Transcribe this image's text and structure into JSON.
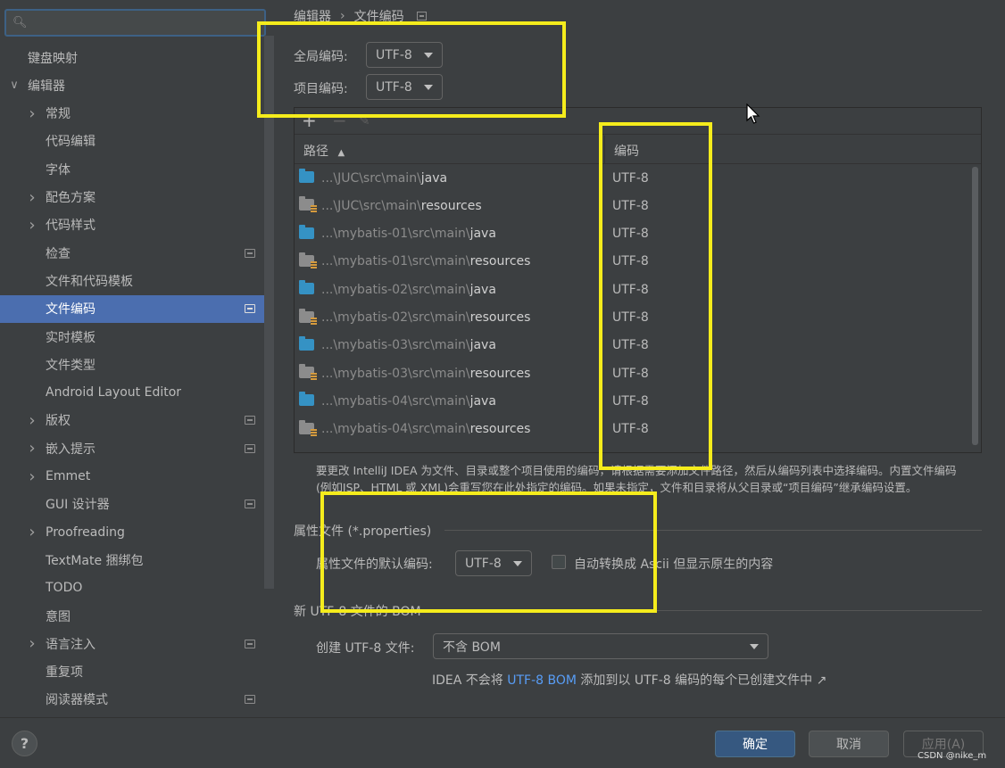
{
  "sidebar": {
    "search": {
      "placeholder": "",
      "icon": "search-icon"
    },
    "items": [
      {
        "label": "键盘映射",
        "level": 0,
        "arrow": "",
        "proj": false,
        "selected": false
      },
      {
        "label": "编辑器",
        "level": 0,
        "arrow": "expanded",
        "proj": false,
        "selected": false
      },
      {
        "label": "常规",
        "level": 1,
        "arrow": "collapsed",
        "proj": false,
        "selected": false
      },
      {
        "label": "代码编辑",
        "level": 1,
        "arrow": "",
        "proj": false,
        "selected": false
      },
      {
        "label": "字体",
        "level": 1,
        "arrow": "",
        "proj": false,
        "selected": false
      },
      {
        "label": "配色方案",
        "level": 1,
        "arrow": "collapsed",
        "proj": false,
        "selected": false
      },
      {
        "label": "代码样式",
        "level": 1,
        "arrow": "collapsed",
        "proj": false,
        "selected": false
      },
      {
        "label": "检查",
        "level": 1,
        "arrow": "",
        "proj": true,
        "selected": false
      },
      {
        "label": "文件和代码模板",
        "level": 1,
        "arrow": "",
        "proj": false,
        "selected": false
      },
      {
        "label": "文件编码",
        "level": 1,
        "arrow": "",
        "proj": true,
        "selected": true
      },
      {
        "label": "实时模板",
        "level": 1,
        "arrow": "",
        "proj": false,
        "selected": false
      },
      {
        "label": "文件类型",
        "level": 1,
        "arrow": "",
        "proj": false,
        "selected": false
      },
      {
        "label": "Android Layout Editor",
        "level": 1,
        "arrow": "",
        "proj": false,
        "selected": false
      },
      {
        "label": "版权",
        "level": 1,
        "arrow": "collapsed",
        "proj": true,
        "selected": false
      },
      {
        "label": "嵌入提示",
        "level": 1,
        "arrow": "collapsed",
        "proj": true,
        "selected": false
      },
      {
        "label": "Emmet",
        "level": 1,
        "arrow": "collapsed",
        "proj": false,
        "selected": false
      },
      {
        "label": "GUI 设计器",
        "level": 1,
        "arrow": "",
        "proj": true,
        "selected": false
      },
      {
        "label": "Proofreading",
        "level": 1,
        "arrow": "collapsed",
        "proj": false,
        "selected": false
      },
      {
        "label": "TextMate 捆绑包",
        "level": 1,
        "arrow": "",
        "proj": false,
        "selected": false
      },
      {
        "label": "TODO",
        "level": 1,
        "arrow": "",
        "proj": false,
        "selected": false
      },
      {
        "label": "意图",
        "level": 1,
        "arrow": "",
        "proj": false,
        "selected": false
      },
      {
        "label": "语言注入",
        "level": 1,
        "arrow": "collapsed",
        "proj": true,
        "selected": false
      },
      {
        "label": "重复项",
        "level": 1,
        "arrow": "",
        "proj": false,
        "selected": false
      },
      {
        "label": "阅读器模式",
        "level": 1,
        "arrow": "",
        "proj": true,
        "selected": false
      }
    ]
  },
  "breadcrumb": {
    "parent": "编辑器",
    "separator": "›",
    "current": "文件编码"
  },
  "global_encoding": {
    "label": "全局编码:",
    "value": "UTF-8"
  },
  "project_encoding": {
    "label": "项目编码:",
    "value": "UTF-8"
  },
  "table": {
    "toolbar": {
      "add": "+",
      "remove": "−",
      "edit": "✎"
    },
    "columns": {
      "path": "路径",
      "sort_arrow": "▲",
      "encoding": "编码"
    },
    "rows": [
      {
        "prefix": "...\\JUC\\src\\main\\",
        "name": "java",
        "type": "src",
        "encoding": "UTF-8"
      },
      {
        "prefix": "...\\JUC\\src\\main\\",
        "name": "resources",
        "type": "res",
        "encoding": "UTF-8"
      },
      {
        "prefix": "...\\mybatis-01\\src\\main\\",
        "name": "java",
        "type": "src",
        "encoding": "UTF-8"
      },
      {
        "prefix": "...\\mybatis-01\\src\\main\\",
        "name": "resources",
        "type": "res",
        "encoding": "UTF-8"
      },
      {
        "prefix": "...\\mybatis-02\\src\\main\\",
        "name": "java",
        "type": "src",
        "encoding": "UTF-8"
      },
      {
        "prefix": "...\\mybatis-02\\src\\main\\",
        "name": "resources",
        "type": "res",
        "encoding": "UTF-8"
      },
      {
        "prefix": "...\\mybatis-03\\src\\main\\",
        "name": "java",
        "type": "src",
        "encoding": "UTF-8"
      },
      {
        "prefix": "...\\mybatis-03\\src\\main\\",
        "name": "resources",
        "type": "res",
        "encoding": "UTF-8"
      },
      {
        "prefix": "...\\mybatis-04\\src\\main\\",
        "name": "java",
        "type": "src",
        "encoding": "UTF-8"
      },
      {
        "prefix": "...\\mybatis-04\\src\\main\\",
        "name": "resources",
        "type": "res",
        "encoding": "UTF-8"
      }
    ]
  },
  "help_text": {
    "line1": "要更改 IntelliJ IDEA 为文件、目录或整个项目使用的编码，请根据需要添加文件路径，然后从编码列表中选择编码。内置文件编码",
    "line2": "(例如JSP、HTML 或 XML)会重写您在此处指定的编码。如果未指定，文件和目录将从父目录或“项目编码”继承编码设置。"
  },
  "properties": {
    "section_title": "属性文件 (*.properties)",
    "default_label": "属性文件的默认编码:",
    "default_value": "UTF-8",
    "native_ascii_label": "自动转换成 Ascii 但显示原生的内容",
    "native_ascii_checked": false
  },
  "bom": {
    "section_title": "新 UTF-8 文件的 BOM",
    "create_label": "创建 UTF-8 文件:",
    "create_value": "不含 BOM",
    "note_prefix": "IDEA 不会将",
    "note_link": "UTF-8 BOM",
    "note_suffix": "添加到以 UTF-8 编码的每个已创建文件中 ↗"
  },
  "footer": {
    "help": "?",
    "ok": "确定",
    "cancel": "取消",
    "apply": "应用(A)",
    "watermark": "CSDN @nike_m"
  },
  "colors": {
    "highlight_box": "#f5ec1c",
    "selection": "#4b6eaf",
    "link": "#589df6",
    "primary_button": "#365880"
  }
}
